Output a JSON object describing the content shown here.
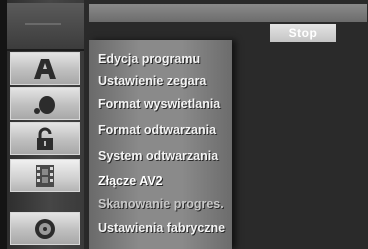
{
  "stop_button": {
    "label": "Stop"
  },
  "sidebar": {
    "icons": [
      {
        "name": "top-panel"
      },
      {
        "name": "letter-a-icon"
      },
      {
        "name": "sound-icon"
      },
      {
        "name": "lock-icon"
      },
      {
        "name": "film-icon"
      },
      {
        "name": "disc-icon"
      }
    ]
  },
  "menu": {
    "items": [
      {
        "label": "Edycja programu"
      },
      {
        "label": "Ustawienie zegara"
      },
      {
        "label": "Format wyswietlania"
      },
      {
        "label": "Format odtwarzania"
      },
      {
        "label": "System odtwarzania"
      },
      {
        "label": "Złącze AV2"
      },
      {
        "label": "Skanowanie progres."
      },
      {
        "label": "Ustawienia fabryczne"
      }
    ]
  },
  "colors": {
    "background": "#141414",
    "panel": "#8a8a8a",
    "text": "#f4f4f4"
  }
}
